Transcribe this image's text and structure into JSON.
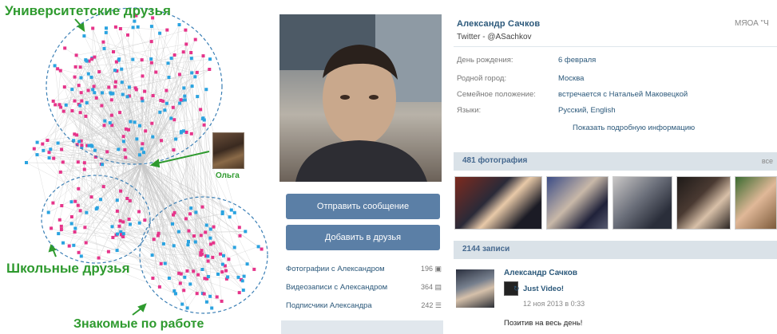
{
  "graph": {
    "clusters": {
      "university": "Университетские друзья",
      "school": "Школьные друзья",
      "work": "Знакомые по работе"
    },
    "highlighted_person": "Ольга",
    "colors": {
      "label": "#2e9a2e",
      "node_a": "#e6348a",
      "node_b": "#2aa3e0",
      "edge": "#c8c8c8",
      "ellipse": "#3b7fb5"
    }
  },
  "sidebar": {
    "send_message": "Отправить сообщение",
    "add_friend": "Добавить в друзья",
    "links": [
      {
        "label": "Фотографии с Александром",
        "count": "196"
      },
      {
        "label": "Видеозаписи с Александром",
        "count": "364"
      },
      {
        "label": "Подписчики Александра",
        "count": "242"
      }
    ]
  },
  "profile": {
    "name": "Александр Сачков",
    "status": "Twitter - @ASachkov",
    "online": "МЯОА \"Ч",
    "info": [
      {
        "label": "День рождения:",
        "value": "6 февраля"
      },
      {
        "label": "Родной город:",
        "value": "Москва"
      },
      {
        "label": "Семейное положение:",
        "value": "встречается с Натальей Маковецкой"
      },
      {
        "label": "Языки:",
        "value": "Русский, English"
      }
    ],
    "show_more": "Показать подробную информацию",
    "photos_header": "481 фотография",
    "photos_all": "все",
    "posts_header": "2144 записи",
    "post": {
      "author": "Александр Сачков",
      "repost_name": "Just Video!",
      "date": "12 ноя 2013 в 0:33",
      "text": "Позитив на весь день!"
    }
  }
}
